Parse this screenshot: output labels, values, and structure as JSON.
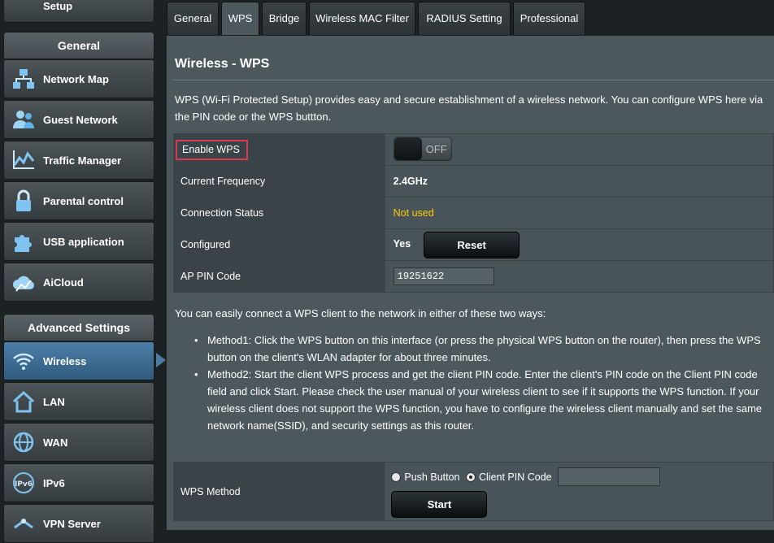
{
  "sidebar": {
    "setup_label": "Setup",
    "general_header": "General",
    "general_items": [
      {
        "label": "Network Map",
        "icon": "network-map-icon"
      },
      {
        "label": "Guest Network",
        "icon": "guest-network-icon"
      },
      {
        "label": "Traffic Manager",
        "icon": "traffic-manager-icon"
      },
      {
        "label": "Parental control",
        "icon": "lock-icon"
      },
      {
        "label": "USB application",
        "icon": "puzzle-icon"
      },
      {
        "label": "AiCloud",
        "icon": "cloud-icon"
      }
    ],
    "advanced_header": "Advanced Settings",
    "advanced_items": [
      {
        "label": "Wireless",
        "icon": "wifi-icon",
        "active": true
      },
      {
        "label": "LAN",
        "icon": "home-icon"
      },
      {
        "label": "WAN",
        "icon": "globe-icon"
      },
      {
        "label": "IPv6",
        "icon": "ipv6-icon"
      },
      {
        "label": "VPN Server",
        "icon": "vpn-icon"
      }
    ]
  },
  "tabs": [
    {
      "label": "General"
    },
    {
      "label": "WPS",
      "active": true
    },
    {
      "label": "Bridge"
    },
    {
      "label": "Wireless MAC Filter"
    },
    {
      "label": "RADIUS Setting"
    },
    {
      "label": "Professional"
    }
  ],
  "page": {
    "title": "Wireless - WPS",
    "description": "WPS (Wi-Fi Protected Setup) provides easy and secure establishment of a wireless network. You can configure WPS here via the PIN code or the WPS buttton.",
    "rows": {
      "enable_wps_label": "Enable WPS",
      "toggle_state": "OFF",
      "frequency_label": "Current Frequency",
      "frequency_value": "2.4GHz",
      "status_label": "Connection Status",
      "status_value": "Not used",
      "configured_label": "Configured",
      "configured_value": "Yes",
      "reset_label": "Reset",
      "pin_label": "AP PIN Code",
      "pin_value": "19251622"
    },
    "intro_text": "You can easily connect a WPS client to the network in either of these two ways:",
    "method1": "Method1: Click the WPS button on this interface (or press the physical WPS button on the router), then press the WPS button on the client's WLAN adapter for about three minutes.",
    "method2": "Method2: Start the client WPS process and get the client PIN code. Enter the client's PIN code on the Client PIN code field and click Start. Please check the user manual of your wireless client to see if it supports the WPS function. If your wireless client does not support the WPS function, you have to configure the wireless client manually and set the same network name(SSID), and security settings as this router.",
    "wps_method_label": "WPS Method",
    "push_button_label": "Push Button",
    "client_pin_label": "Client PIN Code",
    "selected_method": "Client PIN Code",
    "client_pin_value": "",
    "start_label": "Start"
  },
  "colors": {
    "panel_bg": "#4d585d",
    "active_nav": "#4c7fa7",
    "status_warning": "#ffcc00",
    "highlight_border": "#d83a52"
  }
}
